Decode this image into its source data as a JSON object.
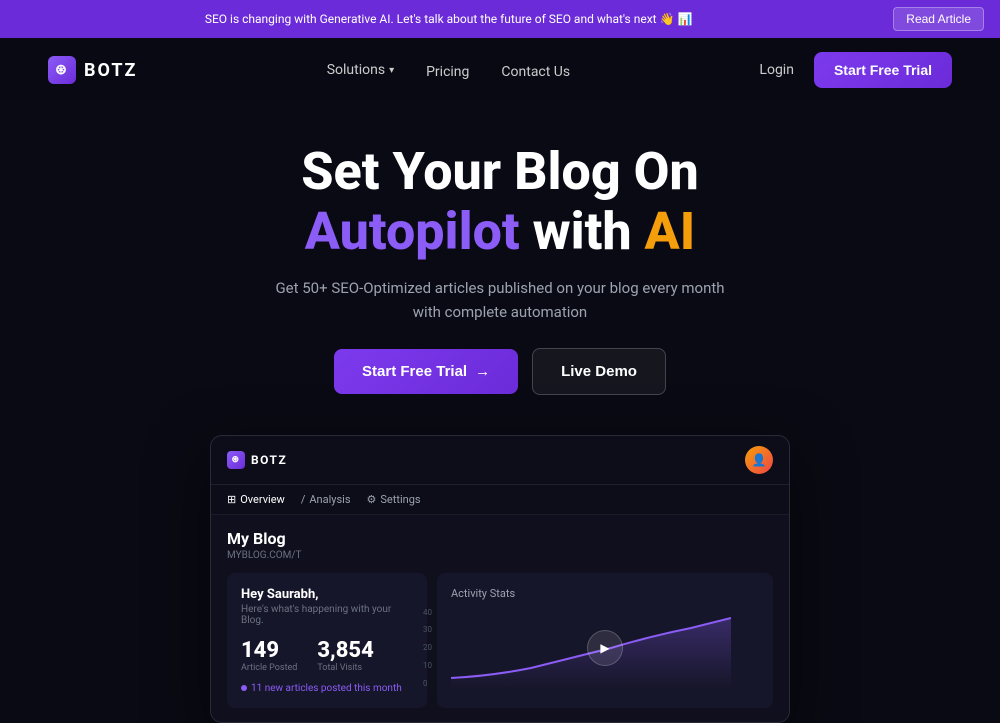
{
  "banner": {
    "text": "SEO is changing with Generative AI. Let's talk about the future of SEO and what's next 👋 📊",
    "cta": "Read Article"
  },
  "nav": {
    "logo": "BOTZ",
    "links": [
      {
        "label": "Solutions",
        "has_chevron": true
      },
      {
        "label": "Pricing"
      },
      {
        "label": "Contact Us"
      },
      {
        "label": "Login"
      }
    ],
    "cta": "Start Free Trial"
  },
  "hero": {
    "line1": "Set Your Blog On",
    "line2_purple": "Autopilot",
    "line2_mid": " with ",
    "line2_gold": "AI",
    "subtitle_line1": "Get 50+ SEO-Optimized articles published on your blog every month",
    "subtitle_line2": "with complete automation",
    "cta_primary": "Start Free Trial",
    "cta_arrow": "→",
    "cta_secondary": "Live Demo"
  },
  "dashboard": {
    "logo": "BOTZ",
    "nav_items": [
      {
        "label": "Overview",
        "active": true,
        "icon": "⊞"
      },
      {
        "label": "Analysis",
        "active": false,
        "icon": "/"
      },
      {
        "label": "Settings",
        "active": false,
        "icon": "⚙"
      }
    ],
    "blog_title": "My Blog",
    "blog_url": "MYBLOG.COM/T",
    "greeting": "Hey Saurabh,",
    "greeting_sub": "Here's what's happening with your Blog.",
    "stats": [
      {
        "value": "149",
        "label": "Article Posted"
      },
      {
        "value": "3,854",
        "label": "Total Visits"
      }
    ],
    "badge_text": "11 new articles posted this month",
    "activity_title": "Activity Stats",
    "chart_y_labels": [
      "40",
      "30",
      "20",
      "10",
      "0"
    ]
  }
}
